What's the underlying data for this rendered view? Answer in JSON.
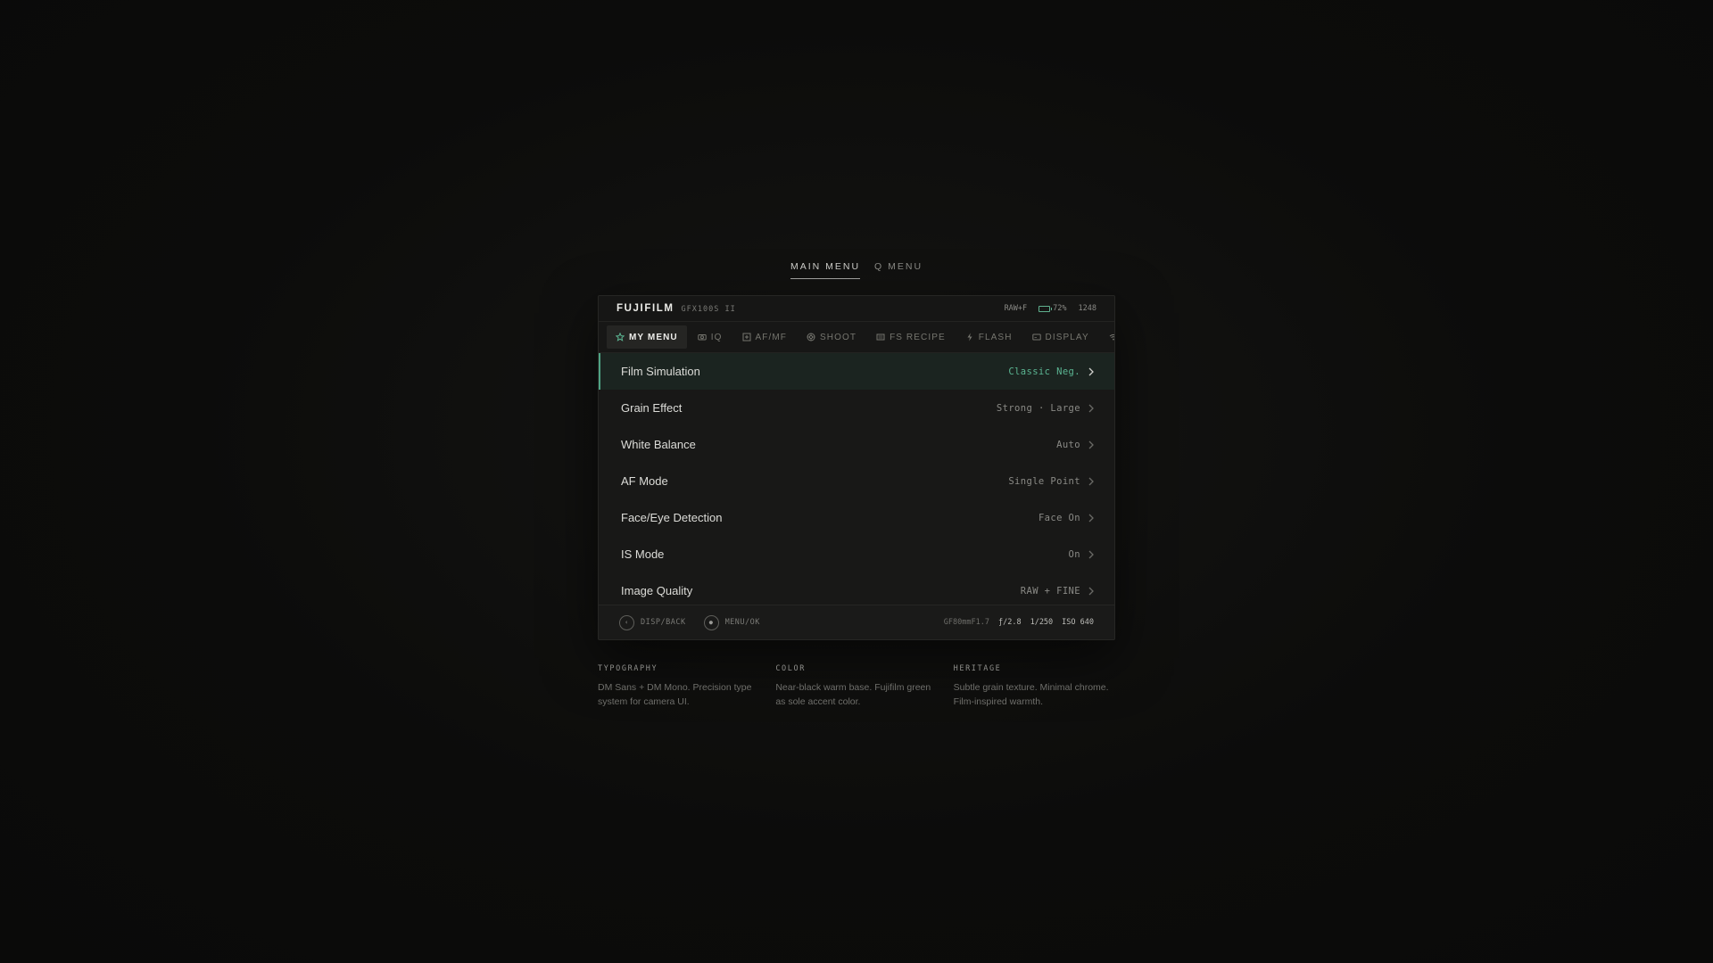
{
  "mode_switch": {
    "main_label": "MAIN MENU",
    "q_label": "Q MENU"
  },
  "header": {
    "brand": "FUJIFILM",
    "model": "GFX100S II",
    "format": "RAW+F",
    "battery_percent": "72%",
    "battery_level": 0.72,
    "shots_remaining": "1248"
  },
  "tabs": [
    {
      "label": "MY MENU",
      "icon": "star-icon",
      "active": true
    },
    {
      "label": "IQ",
      "icon": "camera-icon"
    },
    {
      "label": "AF/MF",
      "icon": "focus-icon"
    },
    {
      "label": "SHOOT",
      "icon": "shutter-icon"
    },
    {
      "label": "FS RECIPE",
      "icon": "recipe-icon"
    },
    {
      "label": "FLASH",
      "icon": "flash-icon"
    },
    {
      "label": "DISPLAY",
      "icon": "display-icon"
    },
    {
      "label": "",
      "icon": "wifi-icon"
    }
  ],
  "menu": [
    {
      "label": "Film Simulation",
      "value": "Classic Neg.",
      "selected": true
    },
    {
      "label": "Grain Effect",
      "value": "Strong · Large"
    },
    {
      "label": "White Balance",
      "value": "Auto"
    },
    {
      "label": "AF Mode",
      "value": "Single Point"
    },
    {
      "label": "Face/Eye Detection",
      "value": "Face On"
    },
    {
      "label": "IS Mode",
      "value": "On"
    },
    {
      "label": "Image Quality",
      "value": "RAW + FINE"
    }
  ],
  "footer": {
    "back_hint": "DISP/BACK",
    "ok_hint": "MENU/OK",
    "lens": "GF80mmF1.7",
    "aperture": "ƒ/2.8",
    "shutter": "1/250",
    "iso": "ISO 640"
  },
  "notes": [
    {
      "title": "TYPOGRAPHY",
      "text": "DM Sans + DM Mono. Precision type system for camera UI."
    },
    {
      "title": "COLOR",
      "text": "Near-black warm base. Fujifilm green as sole accent color."
    },
    {
      "title": "HERITAGE",
      "text": "Subtle grain texture. Minimal chrome. Film-inspired warmth."
    }
  ],
  "colors": {
    "accent": "#4fa383",
    "background": "#0c0c0b",
    "panel": "#181817"
  }
}
